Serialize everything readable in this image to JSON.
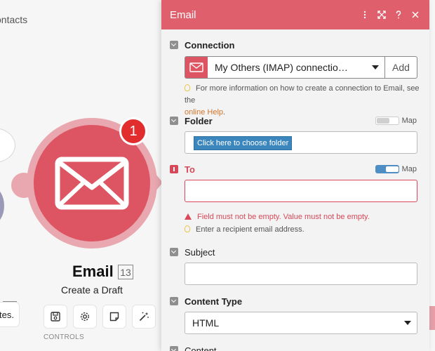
{
  "canvas": {
    "scenario_title": "ontacts",
    "module": {
      "name": "Email",
      "id": "13",
      "action": "Create a Draft",
      "badge": "1",
      "color": "#dd5563"
    },
    "notes_label": "tes.",
    "controls_label": "CONTROLS",
    "controls": [
      {
        "icon": "save-icon"
      },
      {
        "icon": "gear-icon"
      },
      {
        "icon": "note-icon"
      },
      {
        "icon": "magic-wand-icon"
      }
    ]
  },
  "panel": {
    "title": "Email",
    "header_color": "#df5f6c",
    "header_icons": [
      "more-icon",
      "expand-icon",
      "help-icon",
      "close-icon"
    ],
    "connection": {
      "label": "Connection",
      "value": "My Others (IMAP) connectio…",
      "add_label": "Add",
      "hint_prefix": "For more information on how to create a connection to Email, see the",
      "hint_link": "online Help",
      "hint_suffix": "."
    },
    "folder": {
      "label": "Folder",
      "map_label": "Map",
      "map_on": false,
      "button_label": "Click here to choose folder"
    },
    "to": {
      "label": "To",
      "map_label": "Map",
      "map_on": true,
      "value": "",
      "error": "Field must not be empty. Value must not be empty.",
      "hint": "Enter a recipient email address."
    },
    "subject": {
      "label": "Subject",
      "value": ""
    },
    "content_type": {
      "label": "Content Type",
      "value": "HTML"
    },
    "content": {
      "label": "Content"
    }
  }
}
